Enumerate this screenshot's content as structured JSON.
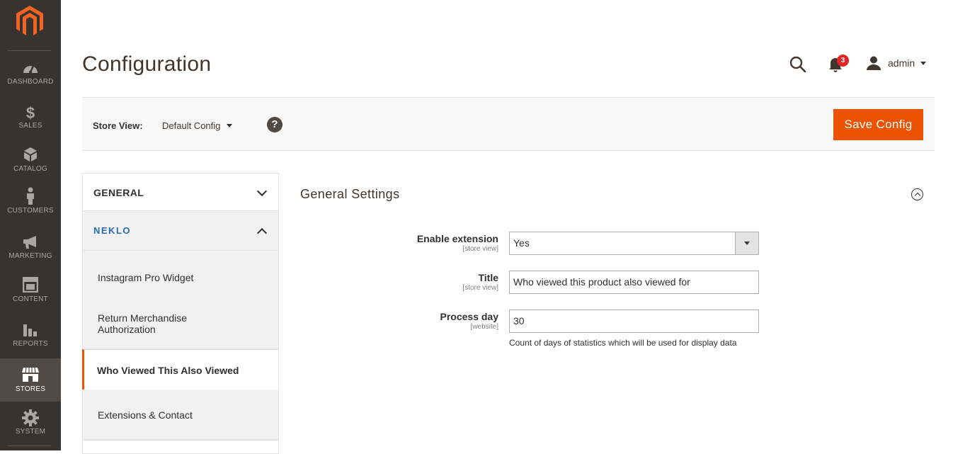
{
  "nav": {
    "items": [
      {
        "label": "DASHBOARD",
        "icon": "dashboard-icon"
      },
      {
        "label": "SALES",
        "icon": "dollar-icon"
      },
      {
        "label": "CATALOG",
        "icon": "cube-icon"
      },
      {
        "label": "CUSTOMERS",
        "icon": "person-icon"
      },
      {
        "label": "MARKETING",
        "icon": "megaphone-icon"
      },
      {
        "label": "CONTENT",
        "icon": "layout-icon"
      },
      {
        "label": "REPORTS",
        "icon": "bar-chart-icon"
      },
      {
        "label": "STORES",
        "icon": "store-icon"
      },
      {
        "label": "SYSTEM",
        "icon": "gear-icon"
      }
    ],
    "active": "STORES"
  },
  "header": {
    "title": "Configuration",
    "notifications_count": "3",
    "user": "admin"
  },
  "store_bar": {
    "label": "Store View:",
    "selected": "Default Config",
    "help": "?",
    "save_label": "Save Config"
  },
  "tabs": {
    "general": "GENERAL",
    "vendor": "NEKLO",
    "items": [
      "Instagram Pro Widget",
      "Return Merchandise Authorization",
      "Who Viewed This Also Viewed",
      "Extensions & Contact"
    ],
    "active": "Who Viewed This Also Viewed"
  },
  "section": {
    "title": "General Settings",
    "fields": {
      "enable": {
        "label": "Enable extension",
        "scope": "[store view]",
        "value": "Yes"
      },
      "title": {
        "label": "Title",
        "scope": "[store view]",
        "value": "Who viewed this product also viewed for"
      },
      "process_day": {
        "label": "Process day",
        "scope": "[website]",
        "value": "30",
        "note": "Count of days of statistics which will be used for display data"
      }
    }
  },
  "colors": {
    "accent": "#eb5202",
    "nav_bg": "#373330",
    "nav_active": "#514943",
    "badge": "#e22626"
  }
}
